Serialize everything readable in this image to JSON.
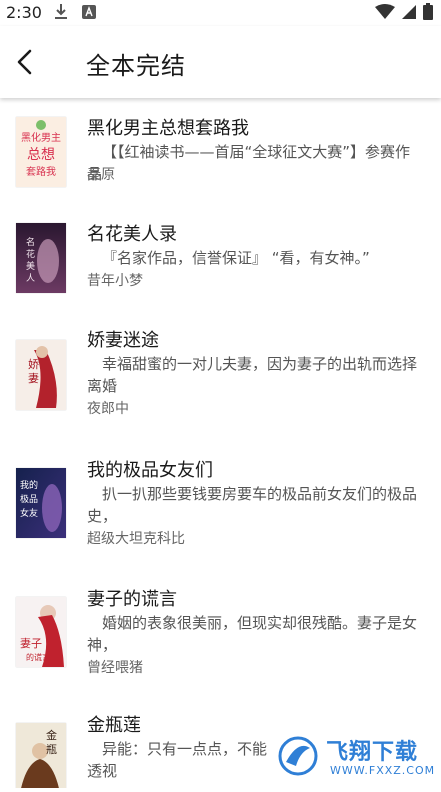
{
  "status_bar": {
    "time": "2:30"
  },
  "header": {
    "title": "全本完结"
  },
  "books": [
    {
      "title": "黑化男主总想套路我",
      "description": "【【红袖读书——首届“全球征文大赛”】参赛作品",
      "author": "秦原",
      "cover_text": "黑化男主总想套路我",
      "cover_colors": [
        "#f7e8d8",
        "#d9405a"
      ]
    },
    {
      "title": "名花美人录",
      "description": "『名家作品，信誉保证』 “看，有女神。”",
      "author": "昔年小梦",
      "cover_text": "名花美人录",
      "cover_colors": [
        "#2a1730",
        "#b07ca0"
      ]
    },
    {
      "title": "娇妻迷途",
      "description": "幸福甜蜜的一对儿夫妻，因为妻子的出轨而选择离婚",
      "author": "夜郎中",
      "cover_text": "娇妻迷途",
      "cover_colors": [
        "#f4ece6",
        "#b3222c"
      ]
    },
    {
      "title": "我的极品女友们",
      "description": "扒一扒那些要钱要房要车的极品前女友们的极品史，",
      "author": "超级大坦克科比",
      "cover_text": "我的极品女友们",
      "cover_colors": [
        "#15214d",
        "#8a63b7"
      ]
    },
    {
      "title": "妻子的谎言",
      "description": "婚姻的表象很美丽，但现实却很残酷。妻子是女神，",
      "author": "曾经喂猪",
      "cover_text": "妻子的谎言",
      "cover_colors": [
        "#f6f1f1",
        "#c0222e"
      ]
    },
    {
      "title": "金瓶莲",
      "description": "异能：只有一点点，不能",
      "description_line2": "透视",
      "author": "",
      "cover_text": "金瓶莲",
      "cover_colors": [
        "#eee7d7",
        "#3a2418"
      ]
    }
  ],
  "watermark": {
    "brand_text": "飞翔下载",
    "url_text": "WWW.FXXZ.COM"
  },
  "colors": {
    "title": "#1a1a1a",
    "text_secondary": "#555555",
    "watermark_blue": "#2f7fd6"
  }
}
